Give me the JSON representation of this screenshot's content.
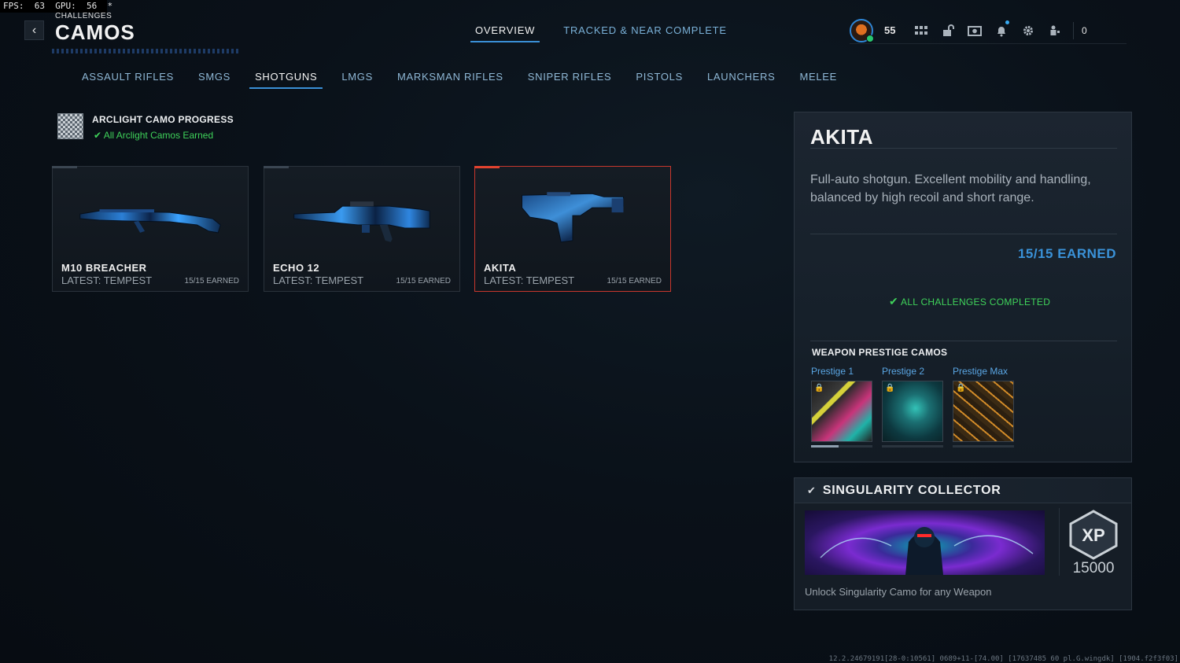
{
  "debug": {
    "fps_overlay": "FPS:  63  GPU:  56  *"
  },
  "header": {
    "breadcrumb": "CHALLENGES",
    "title": "CAMOS",
    "tabs": [
      {
        "label": "OVERVIEW",
        "active": true
      },
      {
        "label": "TRACKED & NEAR COMPLETE",
        "active": false
      }
    ]
  },
  "hud": {
    "player_level": "55",
    "currency": "0",
    "icons": [
      "grid-icon",
      "unlock-icon",
      "camera-icon",
      "bell-icon",
      "gear-icon",
      "party-icon"
    ]
  },
  "categories": [
    {
      "label": "ASSAULT RIFLES",
      "active": false
    },
    {
      "label": "SMGS",
      "active": false
    },
    {
      "label": "SHOTGUNS",
      "active": true
    },
    {
      "label": "LMGS",
      "active": false
    },
    {
      "label": "MARKSMAN RIFLES",
      "active": false
    },
    {
      "label": "SNIPER RIFLES",
      "active": false
    },
    {
      "label": "PISTOLS",
      "active": false
    },
    {
      "label": "LAUNCHERS",
      "active": false
    },
    {
      "label": "MELEE",
      "active": false
    }
  ],
  "arclight": {
    "title": "ARCLIGHT CAMO PROGRESS",
    "status": "All Arclight Camos Earned"
  },
  "weapons": [
    {
      "name": "M10 BREACHER",
      "latest": "LATEST: TEMPEST",
      "earned": "15/15 EARNED",
      "selected": false
    },
    {
      "name": "ECHO 12",
      "latest": "LATEST: TEMPEST",
      "earned": "15/15 EARNED",
      "selected": false
    },
    {
      "name": "AKITA",
      "latest": "LATEST: TEMPEST",
      "earned": "15/15 EARNED",
      "selected": true
    }
  ],
  "detail": {
    "name": "AKITA",
    "description": "Full-auto shotgun. Excellent mobility and handling, balanced by high recoil and short range.",
    "earned": "15/15 EARNED",
    "all_challenges": "ALL CHALLENGES COMPLETED",
    "prestige_title": "WEAPON PRESTIGE CAMOS",
    "prestige": [
      {
        "label": "Prestige 1",
        "locked": true,
        "progress": 0.45
      },
      {
        "label": "Prestige 2",
        "locked": true,
        "progress": 0
      },
      {
        "label": "Prestige Max",
        "locked": true,
        "progress": 0
      }
    ]
  },
  "singularity": {
    "title": "SINGULARITY COLLECTOR",
    "reward_xp": "15000",
    "xp_badge": "XP",
    "description": "Unlock Singularity Camo for any Weapon"
  },
  "footer": {
    "build": "12.2.24679191[28-0:10561] 0689+11-[74.00] [17637485 60 pl.G.wingdk] [1904.f2f3f03]"
  },
  "colors": {
    "accent": "#3a92d8",
    "success": "#3fd25a",
    "selected_border": "#c8372d"
  }
}
